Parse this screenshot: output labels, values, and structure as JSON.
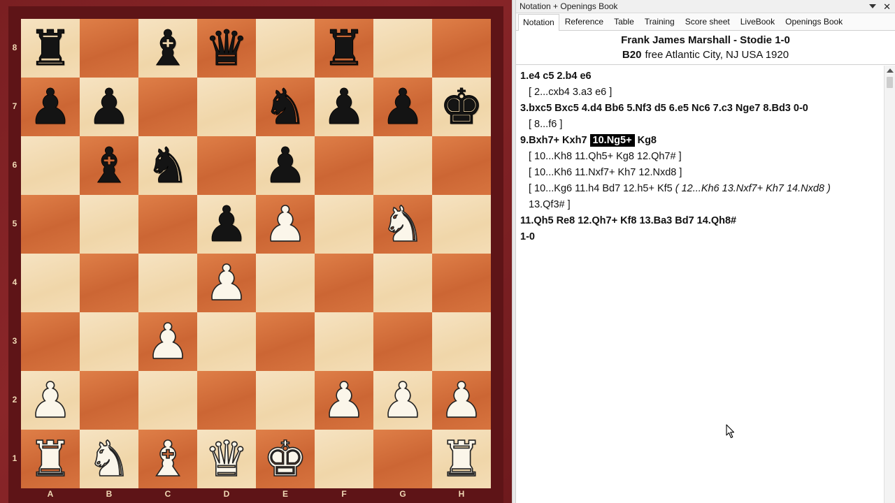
{
  "board": {
    "files": [
      "A",
      "B",
      "C",
      "D",
      "E",
      "F",
      "G",
      "H"
    ],
    "ranks": [
      "8",
      "7",
      "6",
      "5",
      "4",
      "3",
      "2",
      "1"
    ],
    "position": [
      [
        "br",
        "",
        "bb",
        "bq",
        "",
        "br",
        "",
        ""
      ],
      [
        "bp",
        "bp",
        "",
        "",
        "bn",
        "bp",
        "bp",
        "bk"
      ],
      [
        "",
        "bb",
        "bn",
        "",
        "bp",
        "",
        "",
        ""
      ],
      [
        "",
        "",
        "",
        "bp",
        "wp",
        "",
        "wn",
        ""
      ],
      [
        "",
        "",
        "",
        "wp",
        "",
        "",
        "",
        ""
      ],
      [
        "",
        "",
        "wp",
        "",
        "",
        "",
        "",
        ""
      ],
      [
        "wp",
        "",
        "",
        "",
        "",
        "wp",
        "wp",
        "wp"
      ],
      [
        "wr",
        "wn",
        "wb",
        "wq",
        "wk",
        "",
        "",
        "wr"
      ]
    ],
    "colors": {
      "light": "#f3dcb4",
      "dark": "#d8733e",
      "frame": "#7a1f22"
    }
  },
  "panel": {
    "title": "Notation + Openings Book",
    "tabs": [
      "Notation",
      "Reference",
      "Table",
      "Training",
      "Score sheet",
      "LiveBook",
      "Openings Book"
    ],
    "active_tab": 0
  },
  "game": {
    "white": "Frank James Marshall",
    "black": "Stodie",
    "result": "1-0",
    "players_line": "Frank James Marshall - Stodie  1-0",
    "eco": "B20",
    "event_line": "free Atlantic City, NJ USA 1920"
  },
  "notation": {
    "line1": "1.e4  c5  2.b4  e6",
    "line2": "[ 2...cxb4  3.a3  e6 ]",
    "line3": "3.bxc5  Bxc5  4.d4  Bb6  5.Nf3  d5  6.e5  Nc6  7.c3  Nge7  8.Bd3  0-0",
    "line4": "[ 8...f6 ]",
    "line5_pre": "9.Bxh7+  Kxh7 ",
    "line5_hl": "10.Ng5+",
    "line5_post": " Kg8",
    "line6": "[ 10...Kh8  11.Qh5+  Kg8  12.Qh7# ]",
    "line7": "[ 10...Kh6  11.Nxf7+  Kh7  12.Nxd8 ]",
    "line8_pre": "[ 10...Kg6  11.h4  Bd7  12.h5+  Kf5 ",
    "line8_it": "( 12...Kh6  13.Nxf7+  Kh7  14.Nxd8 )",
    "line9": "13.Qf3# ]",
    "line10": "11.Qh5  Re8  12.Qh7+  Kf8  13.Ba3  Bd7  14.Qh8#",
    "line11": "1-0"
  },
  "icons": {
    "dropdown": "chevron-down-icon",
    "close": "close-icon",
    "cursor": "mouse-pointer-icon"
  }
}
